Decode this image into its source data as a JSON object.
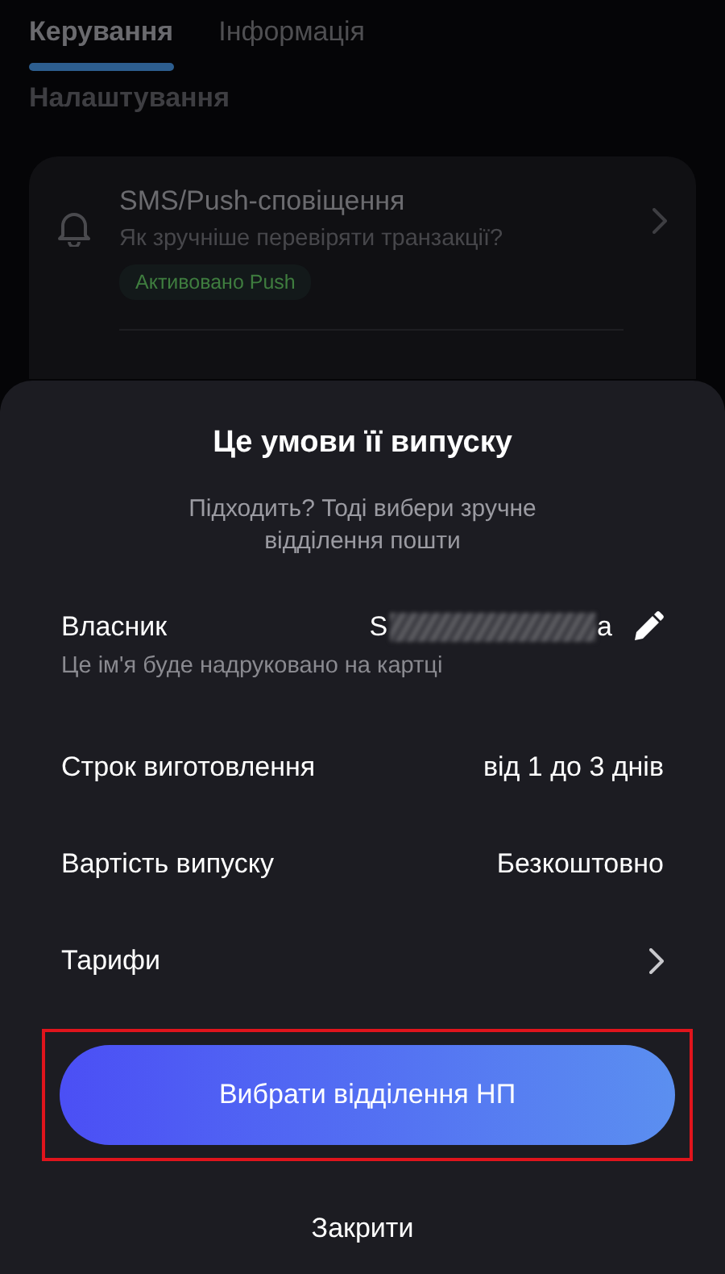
{
  "tabs": [
    {
      "label": "Керування",
      "selected": true
    },
    {
      "label": "Інформація",
      "selected": false
    }
  ],
  "section_title": "Налаштування",
  "settings_item": {
    "title": "SMS/Push-сповіщення",
    "subtitle": "Як зручніше перевіряти транзакції?",
    "badge": "Активовано Push"
  },
  "sheet": {
    "title": "Це умови її випуску",
    "subtitle": "Підходить? Тоді вибери зручне відділення пошти",
    "owner": {
      "label": "Власник",
      "value_start": "S",
      "value_end": "a",
      "hint": "Це ім'я буде надруковано на картці"
    },
    "rows": [
      {
        "kind": "value",
        "label": "Строк виготовлення",
        "value": "від 1 до 3 днів"
      },
      {
        "kind": "value",
        "label": "Вартість випуску",
        "value": "Безкоштовно"
      },
      {
        "kind": "link",
        "label": "Тарифи"
      }
    ],
    "primary_button": {
      "label": "Вибрати відділення НП",
      "highlighted": true
    },
    "close_button": "Закрити"
  }
}
